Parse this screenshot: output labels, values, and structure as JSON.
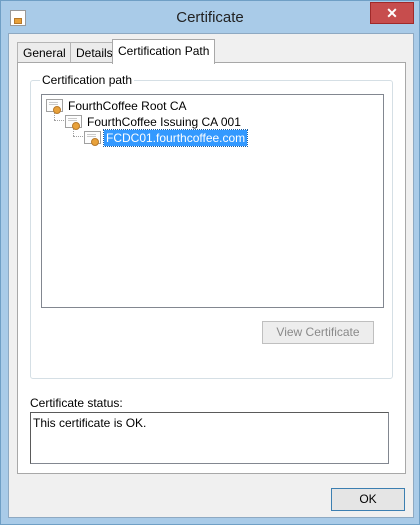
{
  "window": {
    "title": "Certificate",
    "close_glyph": "✕"
  },
  "tabs": [
    {
      "label": "General",
      "active": false
    },
    {
      "label": "Details",
      "active": false
    },
    {
      "label": "Certification Path",
      "active": true
    }
  ],
  "cert_path": {
    "group_label": "Certification path",
    "nodes": [
      {
        "label": "FourthCoffee Root CA",
        "level": 0,
        "selected": false
      },
      {
        "label": "FourthCoffee Issuing CA 001",
        "level": 1,
        "selected": false
      },
      {
        "label": "FCDC01.fourthcoffee.com",
        "level": 2,
        "selected": true
      }
    ],
    "view_button": "View Certificate",
    "view_button_enabled": false
  },
  "status": {
    "label": "Certificate status:",
    "text": "This certificate is OK."
  },
  "footer": {
    "ok_label": "OK"
  },
  "icons": {
    "window_icon": "certificate-icon",
    "node_icon": "certificate-icon"
  },
  "colors": {
    "titlebar": "#a9cbe8",
    "selection": "#3399ff",
    "close": "#c74d4d"
  }
}
